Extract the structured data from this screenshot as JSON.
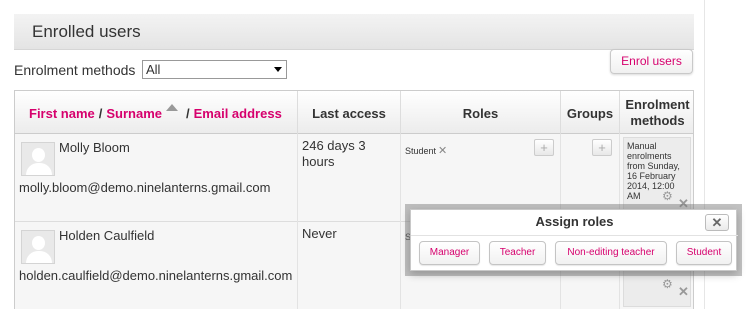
{
  "page": {
    "title": "Enrolled users"
  },
  "toolbar": {
    "enrol_users_label": "Enrol users"
  },
  "filter": {
    "label": "Enrolment methods",
    "selected": "All"
  },
  "table": {
    "headers": {
      "first_name": "First name",
      "separator1": "/",
      "surname": "Surname",
      "separator2": "/",
      "email": "Email address",
      "last_access": "Last access",
      "roles": "Roles",
      "groups": "Groups",
      "enrolment_methods": "Enrolment methods"
    },
    "rows": [
      {
        "name": "Molly Bloom",
        "email": "molly.bloom@demo.ninelanterns.gmail.com",
        "last_access": "246 days 3 hours",
        "role": "Student",
        "enrolment": "Manual enrolments from Sunday, 16 February 2014, 12:00 AM"
      },
      {
        "name": "Holden Caulfield",
        "email": "holden.caulfield@demo.ninelanterns.gmail.com",
        "last_access": "Never",
        "role": "S",
        "enrolment": ""
      }
    ]
  },
  "modal": {
    "title": "Assign roles",
    "close": "✕",
    "roles": [
      "Manager",
      "Teacher",
      "Non-editing teacher",
      "Student"
    ]
  },
  "icons": {
    "plus": "+",
    "remove": "✕",
    "gear": "⚙",
    "close": "✕"
  },
  "colors": {
    "accent": "#d6006d"
  }
}
